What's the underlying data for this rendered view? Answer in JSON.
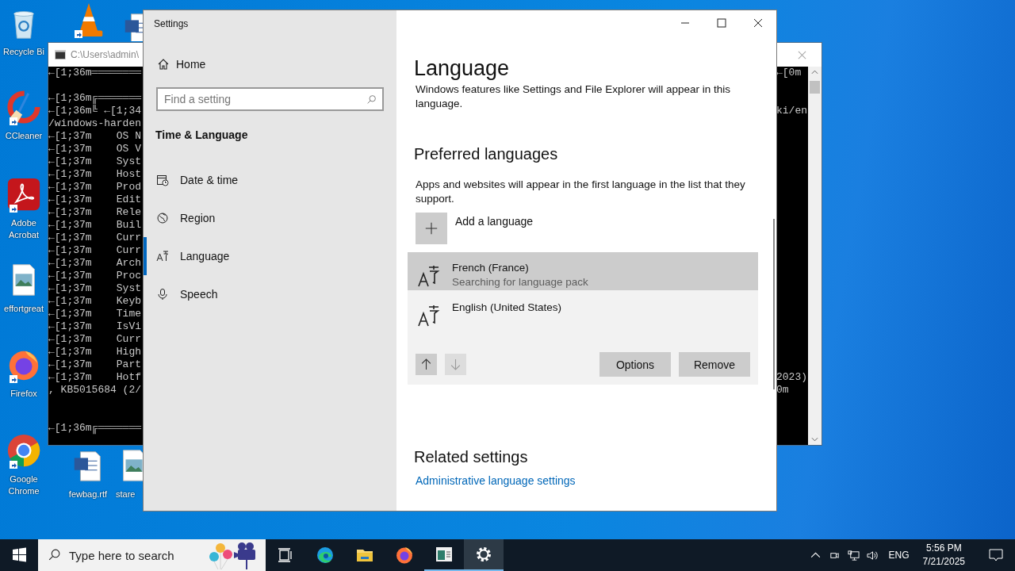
{
  "desktop_icons": [
    {
      "kind": "recycle-bin",
      "label": "Recycle Bi",
      "shortcut": false
    },
    {
      "kind": "cone",
      "shortcut": true
    },
    {
      "kind": "word-doc",
      "shortcut": false
    },
    {
      "kind": "ccleaner",
      "label": "CCleaner",
      "shortcut": true
    },
    {
      "kind": "acrobat",
      "label": "Adobe Acrobat",
      "shortcut": true
    },
    {
      "kind": "image-file",
      "label": "effortgreat",
      "shortcut": false
    },
    {
      "kind": "firefox",
      "label": "Firefox",
      "shortcut": true
    },
    {
      "kind": "chrome",
      "label": "Google Chrome",
      "shortcut": true
    },
    {
      "kind": "word-doc",
      "label": "fewbag.rtf",
      "shortcut": false
    },
    {
      "kind": "image-file",
      "label": "stare",
      "shortcut": false
    }
  ],
  "console": {
    "title": "C:\\Users\\admin\\",
    "rows": [
      {
        "left": "←[1;36m════════",
        "right": "←[0m"
      },
      {},
      {
        "left": "←[1;36m╔═══════"
      },
      {
        "left": "←[1;36m╚ ←[1;34",
        "right": "ki/en"
      },
      {
        "left": "/windows-harden"
      },
      {
        "left": "←[1;37m    OS N"
      },
      {
        "left": "←[1;37m    OS V"
      },
      {
        "left": "←[1;37m    Syst"
      },
      {
        "left": "←[1;37m    Host"
      },
      {
        "left": "←[1;37m    Prod"
      },
      {
        "left": "←[1;37m    Edit"
      },
      {
        "left": "←[1;37m    Rele"
      },
      {
        "left": "←[1;37m    Buil"
      },
      {
        "left": "←[1;37m    Curr"
      },
      {
        "left": "←[1;37m    Curr"
      },
      {
        "left": "←[1;37m    Arch"
      },
      {
        "left": "←[1;37m    Proc"
      },
      {
        "left": "←[1;37m    Syst"
      },
      {
        "left": "←[1;37m    Keyb"
      },
      {
        "left": "←[1;37m    Time"
      },
      {
        "left": "←[1;37m    IsVi"
      },
      {
        "left": "←[1;37m    Curr"
      },
      {
        "left": "←[1;37m    High"
      },
      {
        "left": "←[1;37m    Part"
      },
      {
        "left": "←[1;37m    Hotf",
        "right": "2023)"
      },
      {
        "left": ", KB5015684 (2/",
        "right": "0m"
      },
      {},
      {},
      {
        "left": "←[1;36m╔═══════"
      }
    ]
  },
  "settings": {
    "window": {
      "title": "Settings"
    },
    "sidebar": {
      "home": "Home",
      "search": {
        "placeholder": "Find a setting"
      },
      "group": "Time & Language",
      "items": [
        {
          "kind": "date-time",
          "label": "Date & time",
          "selected": false
        },
        {
          "kind": "region",
          "label": "Region",
          "selected": false
        },
        {
          "kind": "language",
          "label": "Language",
          "selected": true
        },
        {
          "kind": "speech",
          "label": "Speech",
          "selected": false
        }
      ]
    },
    "page": {
      "title": "Language",
      "intro": "Windows features like Settings and File Explorer will appear in this language.",
      "section": "Preferred languages",
      "description": "Apps and websites will appear in the first language in the list that they support.",
      "add_language": "Add a language",
      "languages": [
        {
          "name": "French (France)",
          "status": "Searching for language pack",
          "hovered": true,
          "selected": false
        },
        {
          "name": "English (United States)",
          "hovered": false,
          "selected": true
        }
      ],
      "move_up": {
        "disabled": false
      },
      "move_down": {
        "disabled": true
      },
      "buttons": [
        "Options",
        "Remove"
      ],
      "related_title": "Related settings",
      "related_link": "Administrative language settings"
    }
  },
  "taskbar": {
    "search": {
      "placeholder": "Type here to search"
    },
    "apps": [
      {
        "kind": "task-view",
        "open": false,
        "selected": false
      },
      {
        "kind": "edge",
        "open": false,
        "selected": false
      },
      {
        "kind": "folder",
        "open": false,
        "selected": false
      },
      {
        "kind": "firefox",
        "open": false,
        "selected": false
      },
      {
        "kind": "console",
        "open": true,
        "selected": false
      },
      {
        "kind": "settings",
        "open": true,
        "selected": true
      }
    ],
    "language": "ENG",
    "time": "5:56 PM",
    "date": "7/21/2025"
  }
}
